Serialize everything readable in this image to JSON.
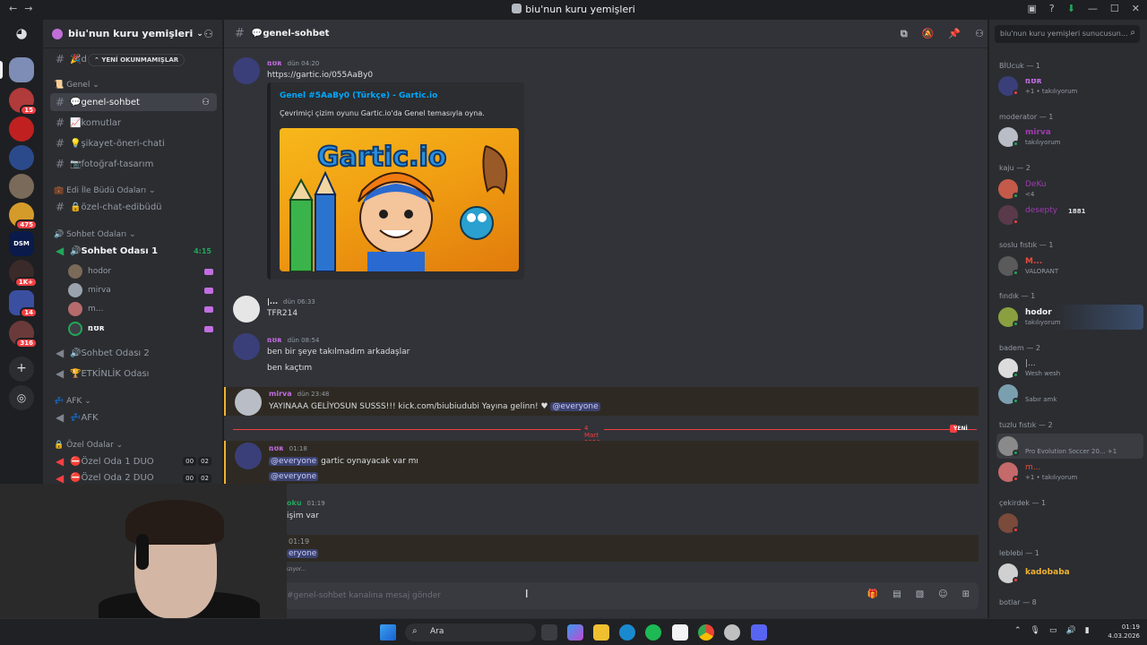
{
  "window": {
    "title": "biu'nun kuru yemişleri"
  },
  "server": {
    "name": "biu'nun kuru yemişleri",
    "unread_pill": "YENİ OKUNMAMIŞLAR",
    "partial_channel": "d"
  },
  "guild_badges": [
    "15",
    "475",
    "1K+",
    "14",
    "316"
  ],
  "guild_label_dsm": "DSM",
  "categories": {
    "genel": "Genel",
    "edi": "Edi İle Büdü Odaları",
    "sohbet": "Sohbet Odaları",
    "afk": "AFK",
    "ozel": "Özel Odalar"
  },
  "channels": {
    "genel_sohbet": "💬genel-sohbet",
    "komutlar": "📈komutlar",
    "sikayet": "💡şikayet-öneri-chati",
    "fotograf": "📷fotoğraf-tasarım",
    "ozel_chat": "🔒özel-chat-edibüdü",
    "sohbet1": "Sohbet Odası 1",
    "sohbet1_timer": "4:15",
    "sohbet2": "Sohbet Odası 2",
    "etkinlik": "🏆ETKİNLİK Odası",
    "afk": "💤AFK",
    "ozel1": "Özel Oda 1 DUO",
    "ozel1_a": "00",
    "ozel1_b": "02",
    "ozel2": "Özel Oda 2 DUO",
    "ozel2_a": "00",
    "ozel2_b": "02"
  },
  "voice_users": [
    "hodor",
    "mirva",
    "m...",
    "ռʊʀ"
  ],
  "channel_header": {
    "name": "💬genel-sohbet"
  },
  "messages": {
    "m1": {
      "author": "ռʊʀ",
      "time": "dün 04:20",
      "link": "https://gartic.io/055AaBy0"
    },
    "embed": {
      "title": "Genel #5AaBy0 (Türkçe) - Gartic.io",
      "desc": "Çevrimiçi çizim oyunu Gartic.io'da Genel temasıyla oyna.",
      "logo": "Gartic.io"
    },
    "m2": {
      "author": "|...",
      "time": "dün 06:33",
      "text": "TFR214"
    },
    "m3": {
      "author": "ռʊʀ",
      "time": "dün 08:54",
      "line1": "ben bir şeye takılmadım arkadaşlar",
      "line2": "ben kaçtım"
    },
    "m4": {
      "author": "mirva",
      "time": "dün 23:48",
      "text": "YAYINAAA GELİYOSUN SUSSS!!! kick.com/biubiudubi Yayına gelinn! ♥",
      "mention": "@everyone"
    },
    "divider": "4 Mart 2026",
    "new_tag": "YENİ",
    "m5": {
      "author": "ռʊʀ",
      "time": "01:18",
      "mention1": "@everyone",
      "text": "gartic oynayacak var mı",
      "mention2": "@everyone"
    },
    "m6": {
      "author": "oku",
      "time": "01:19",
      "text": "işim var"
    },
    "m7": {
      "time": "01:19",
      "mention": "eryone",
      "typing": "ızıyor..."
    }
  },
  "composer": {
    "placeholder": "#genel-sohbet kanalına mesaj gönder"
  },
  "members": {
    "search_placeholder": "biu'nun kuru yemişleri sunucusun...",
    "groups": [
      {
        "label": "BİUcuk — 1"
      },
      {
        "label": "moderator — 1"
      },
      {
        "label": "kaju — 2"
      },
      {
        "label": "soslu fıstık — 1"
      },
      {
        "label": "fındık — 1"
      },
      {
        "label": "badem — 2"
      },
      {
        "label": "tuzlu fıstık — 2"
      },
      {
        "label": "çekirdek — 1"
      },
      {
        "label": "leblebi — 1"
      },
      {
        "label": "botlar — 8"
      }
    ],
    "list": [
      {
        "name": "ռʊʀ",
        "status": "+1 • takılıyorum"
      },
      {
        "name": "mirva",
        "status": "takılıyorum"
      },
      {
        "name": "DeKu",
        "status": "<4"
      },
      {
        "name": "desepty",
        "status": "1881"
      },
      {
        "name": "M...",
        "status": "VALORANT"
      },
      {
        "name": "hodor",
        "status": "takılıyorum"
      },
      {
        "name": "|...",
        "status": "Wesh wesh"
      },
      {
        "name": "",
        "status": "Sabır amk"
      },
      {
        "name": "",
        "status": "Pro Evolution Soccer 20...  +1"
      },
      {
        "name": "m...",
        "status": "+1 • takılıyorum"
      },
      {
        "name": "",
        "status": ""
      },
      {
        "name": "kadobaba",
        "status": ""
      }
    ]
  },
  "taskbar": {
    "search": "Ara",
    "time": "01:19",
    "date": "4.03.2026"
  },
  "colors": {
    "accent": "#5865f2",
    "mention_bar": "#f0b232",
    "new_divider": "#f23f43",
    "online": "#23a55a",
    "link": "#00a8fc"
  }
}
